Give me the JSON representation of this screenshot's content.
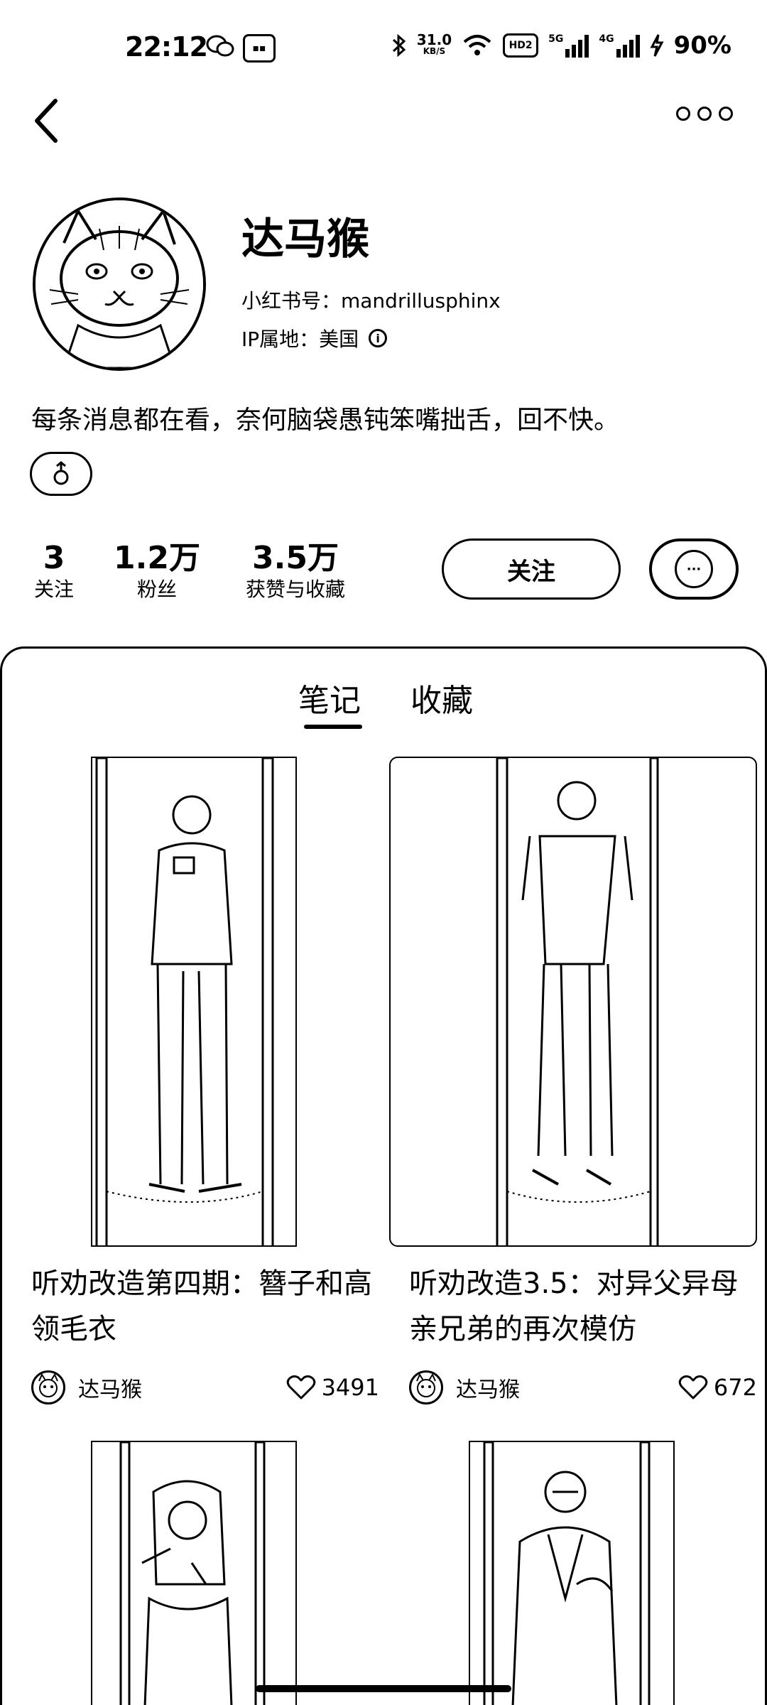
{
  "status_bar": {
    "time": "22:12",
    "net_speed_value": "31.0",
    "net_speed_unit": "KB/S",
    "hd_label": "HD2",
    "sig1_label": "5G",
    "sig2_label": "4G",
    "battery": "90%",
    "icons": [
      "wechat-icon",
      "mini-program-icon",
      "bluetooth-icon",
      "wifi-icon",
      "signal-icon",
      "charging-icon"
    ]
  },
  "header": {
    "back_icon": "chevron-left-icon",
    "more_icon": "more-horizontal-icon"
  },
  "profile": {
    "name": "达马猴",
    "red_id": "小红书号：mandrillusphinx",
    "ip_location": "IP属地：美国",
    "bio": "每条消息都在看，奈何脑袋愚钝笨嘴拙舌，回不快。",
    "gender_icon": "gender-icon"
  },
  "stats": [
    {
      "value": "3",
      "label": "关注"
    },
    {
      "value": "1.2万",
      "label": "粉丝"
    },
    {
      "value": "3.5万",
      "label": "获赞与收藏"
    }
  ],
  "actions": {
    "follow_label": "关注",
    "chat_icon": "chat-icon"
  },
  "tabs": [
    {
      "label": "笔记",
      "active": true
    },
    {
      "label": "收藏",
      "active": false
    }
  ],
  "posts": [
    {
      "title": "听劝改造第四期：簪子和高领毛衣",
      "author": "达马猴",
      "likes": "3491"
    },
    {
      "title": "听劝改造3.5：对异父异母亲兄弟的再次模仿",
      "author": "达马猴",
      "likes": "672"
    }
  ]
}
